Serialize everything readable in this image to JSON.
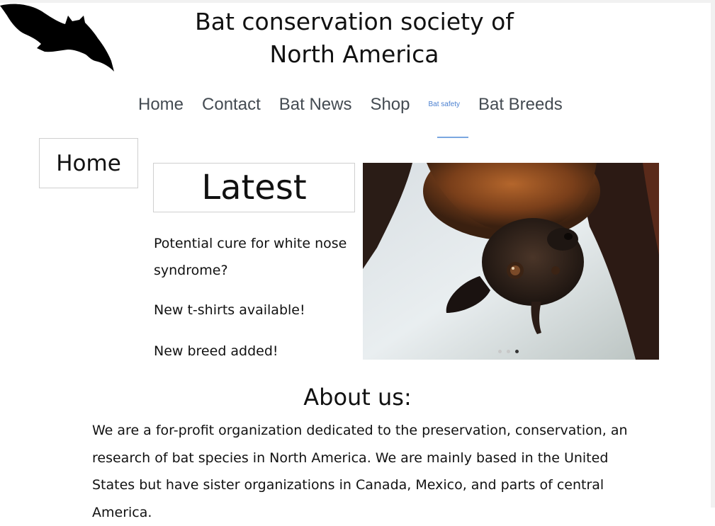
{
  "header": {
    "title": "Bat conservation society of North America",
    "logo_icon": "bat-silhouette-icon"
  },
  "nav": {
    "items": [
      {
        "label": "Home"
      },
      {
        "label": "Contact"
      },
      {
        "label": "Bat News"
      },
      {
        "label": "Shop"
      },
      {
        "label": "Bat safety"
      },
      {
        "label": "Bat Breeds"
      }
    ],
    "active_color": "#4a7fd0"
  },
  "sidebar": {
    "home_label": "Home"
  },
  "latest": {
    "heading": "Latest",
    "items": [
      "Potential cure for white nose syndrome?",
      "New t-shirts available!",
      "New breed added!"
    ]
  },
  "carousel": {
    "image_subject": "fruit bat hanging upside down",
    "slide_count": 3,
    "active_slide": 3
  },
  "about": {
    "heading": "About us:",
    "text": "We are a for-profit organization dedicated to the preservation, conservation, an research of bat species in North America. We are mainly based in the United States but have sister organizations in Canada, Mexico, and parts of central America."
  }
}
